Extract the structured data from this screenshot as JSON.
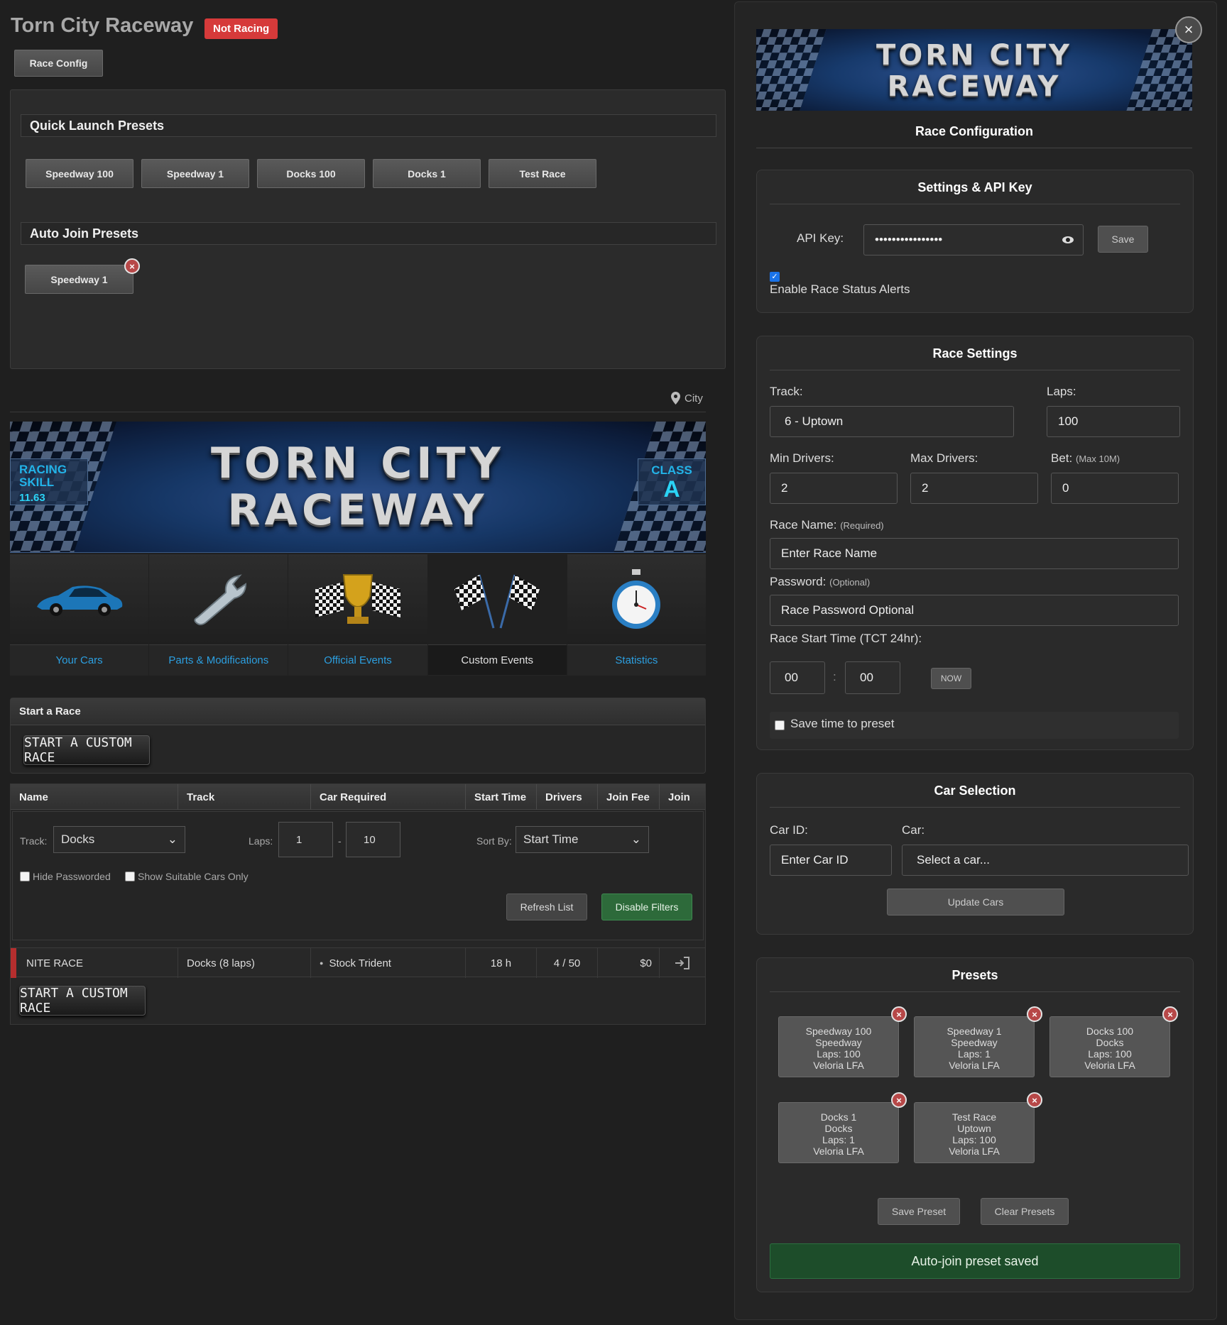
{
  "header": {
    "title": "Torn City Raceway",
    "status_badge": "Not Racing",
    "race_config_button": "Race Config"
  },
  "quick_launch": {
    "heading": "Quick Launch Presets",
    "buttons": [
      "Speedway 100",
      "Speedway 1",
      "Docks 100",
      "Docks 1",
      "Test Race"
    ]
  },
  "auto_join": {
    "heading": "Auto Join Presets",
    "buttons": [
      "Speedway 1"
    ],
    "remove_glyph": "×"
  },
  "location": {
    "label": "City",
    "icon": "map-pin-icon"
  },
  "banner": {
    "title_line1": "TORN CITY",
    "title_line2": "RACEWAY",
    "skill_label_1": "RACING",
    "skill_label_2": "SKILL",
    "skill_value": "11.63",
    "class_label": "CLASS",
    "class_value": "A"
  },
  "nav": {
    "items": [
      {
        "label": "Your Cars",
        "icon": "car-icon"
      },
      {
        "label": "Parts & Modifications",
        "icon": "wrench-icon"
      },
      {
        "label": "Official Events",
        "icon": "trophy-icon"
      },
      {
        "label": "Custom Events",
        "icon": "checkered-flags-icon",
        "active": true
      },
      {
        "label": "Statistics",
        "icon": "stopwatch-icon"
      }
    ]
  },
  "start_race": {
    "heading": "Start a Race",
    "button": "START A CUSTOM RACE"
  },
  "table": {
    "columns": [
      "Name",
      "Track",
      "Car Required",
      "Start Time",
      "Drivers",
      "Join Fee",
      "Join"
    ],
    "filters": {
      "track_label": "Track:",
      "track_value": "Docks",
      "laps_label": "Laps:",
      "laps_min": "1",
      "laps_sep": "-",
      "laps_max": "10",
      "sort_label": "Sort By:",
      "sort_value": "Start Time",
      "hide_passworded": "Hide Passworded",
      "suitable_only": "Show Suitable Cars Only",
      "refresh": "Refresh List",
      "disable_filters": "Disable Filters"
    },
    "rows": [
      {
        "name": "NITE RACE",
        "track": "Docks (8 laps)",
        "car": "Stock Trident",
        "start": "18 h",
        "drivers": "4 / 50",
        "fee": "$0",
        "join_icon": "enter-icon"
      }
    ],
    "bottom_button": "START A CUSTOM RACE"
  },
  "panel": {
    "close_glyph": "×",
    "banner_line1": "TORN CITY",
    "banner_line2": "RACEWAY",
    "title": "Race Configuration",
    "settings": {
      "heading": "Settings & API Key",
      "api_label": "API Key:",
      "api_value": "••••••••••••••••",
      "save": "Save",
      "alerts_label": "Enable Race Status Alerts",
      "alerts_checked": true
    },
    "race_settings": {
      "heading": "Race Settings",
      "track_label": "Track:",
      "track_value": "6 - Uptown",
      "laps_label": "Laps:",
      "laps_value": "100",
      "min_label": "Min Drivers:",
      "min_value": "2",
      "max_label": "Max Drivers:",
      "max_value": "2",
      "bet_label": "Bet:",
      "bet_hint": "(Max 10M)",
      "bet_value": "0",
      "name_label": "Race Name:",
      "name_hint": "(Required)",
      "name_placeholder": "Enter Race Name",
      "password_label": "Password:",
      "password_hint": "(Optional)",
      "password_placeholder": "Race Password Optional",
      "start_label": "Race Start Time (TCT 24hr):",
      "hour": "00",
      "colon": ":",
      "minute": "00",
      "now": "NOW",
      "save_time": "Save time to preset"
    },
    "car_selection": {
      "heading": "Car Selection",
      "car_id_label": "Car ID:",
      "car_id_placeholder": "Enter Car ID",
      "car_label": "Car:",
      "car_value": "Select a car...",
      "update": "Update Cars"
    },
    "presets": {
      "heading": "Presets",
      "items": [
        {
          "name": "Speedway 100",
          "track": "Speedway",
          "laps": "Laps: 100",
          "car": "Veloria LFA"
        },
        {
          "name": "Speedway 1",
          "track": "Speedway",
          "laps": "Laps: 1",
          "car": "Veloria LFA"
        },
        {
          "name": "Docks 100",
          "track": "Docks",
          "laps": "Laps: 100",
          "car": "Veloria LFA"
        },
        {
          "name": "Docks 1",
          "track": "Docks",
          "laps": "Laps: 1",
          "car": "Veloria LFA"
        },
        {
          "name": "Test Race",
          "track": "Uptown",
          "laps": "Laps: 100",
          "car": "Veloria LFA"
        }
      ],
      "save": "Save Preset",
      "clear": "Clear Presets",
      "saved_message": "Auto-join preset saved"
    }
  },
  "colors": {
    "accent_blue": "#2c9fe0",
    "danger_red": "#d63a3a",
    "success_green": "#2d6a3a"
  }
}
